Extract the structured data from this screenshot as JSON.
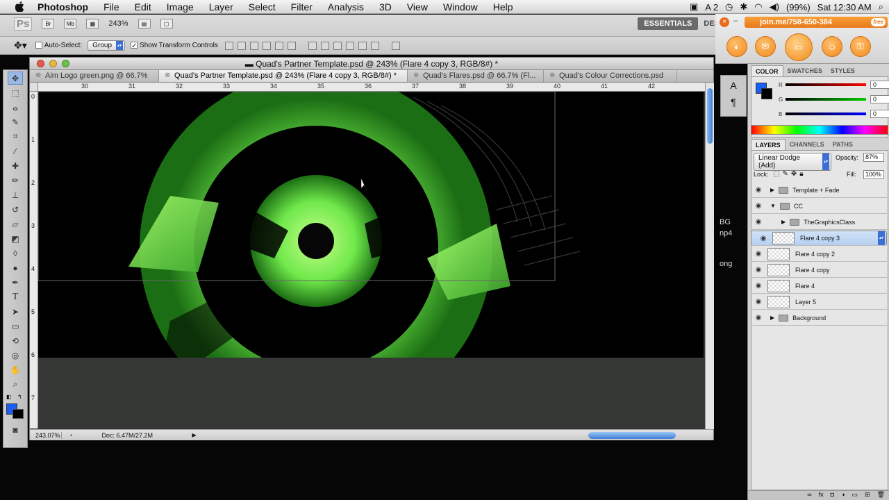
{
  "menubar": {
    "app": "Photoshop",
    "items": [
      "File",
      "Edit",
      "Image",
      "Layer",
      "Select",
      "Filter",
      "Analysis",
      "3D",
      "View",
      "Window",
      "Help"
    ],
    "status": {
      "adobe": "A 2",
      "battery": "(99%)",
      "clock": "Sat 12:30 AM"
    }
  },
  "options": {
    "ps_logo": "Ps",
    "br": "Br",
    "mb": "Mb",
    "zoom": "243%",
    "auto_select_label": "Auto-Select:",
    "auto_select_value": "Group",
    "show_transform": "Show Transform Controls",
    "essentials": "ESSENTIALS",
    "design": "DES"
  },
  "join": {
    "url": "join.me/758-650-384",
    "free": "free"
  },
  "document": {
    "title": "Quad's Partner Template.psd @ 243% (Flare 4 copy 3, RGB/8#) *",
    "tabs": [
      "Aim Logo green.png @ 66.7%",
      "Quad's Partner Template.psd @ 243% (Flare 4 copy 3, RGB/8#) *",
      "Quad's Flares.psd @ 66.7% (Fl...",
      "Quad's Colour Corrections.psd"
    ],
    "ruler_h": [
      "30",
      "31",
      "32",
      "33",
      "34",
      "35",
      "36",
      "37",
      "38",
      "39",
      "40",
      "41",
      "42"
    ],
    "ruler_v": [
      "0",
      "1",
      "2",
      "3",
      "4",
      "5",
      "6",
      "7"
    ],
    "status_zoom": "243.07%",
    "status_doc": "Doc: 6.47M/27.2M"
  },
  "color_panel": {
    "tabs": [
      "COLOR",
      "SWATCHES",
      "STYLES"
    ],
    "r_label": "R",
    "g_label": "G",
    "b_label": "B",
    "r": "0",
    "g": "0",
    "b": "0",
    "foreground": "#1a5ff5"
  },
  "layers_panel": {
    "tabs": [
      "LAYERS",
      "CHANNELS",
      "PATHS"
    ],
    "blend_mode": "Linear Dodge (Add)",
    "opacity_label": "Opacity:",
    "opacity": "87%",
    "lock_label": "Lock:",
    "fill_label": "Fill:",
    "fill": "100%",
    "layers": [
      {
        "name": "Template + Fade",
        "kind": "group",
        "indent": 0,
        "open": false,
        "selected": false
      },
      {
        "name": "CC",
        "kind": "group",
        "indent": 0,
        "open": true,
        "selected": false
      },
      {
        "name": "TheGraphicsClass",
        "kind": "group",
        "indent": 1,
        "open": false,
        "selected": false
      },
      {
        "name": "Flare 4 copy 3",
        "kind": "layer",
        "indent": 0,
        "open": false,
        "selected": true
      },
      {
        "name": "Flare 4 copy 2",
        "kind": "layer",
        "indent": 0,
        "open": false,
        "selected": false
      },
      {
        "name": "Flare 4 copy",
        "kind": "layer",
        "indent": 0,
        "open": false,
        "selected": false
      },
      {
        "name": "Flare 4",
        "kind": "layer",
        "indent": 0,
        "open": false,
        "selected": false
      },
      {
        "name": "Layer 5",
        "kind": "layer",
        "indent": 0,
        "open": false,
        "selected": false
      },
      {
        "name": "Background",
        "kind": "group",
        "indent": 0,
        "open": false,
        "selected": false
      }
    ]
  },
  "side_preview": [
    "BG",
    "np4",
    "ong"
  ],
  "colors": {
    "accent": "#3f7fd6",
    "flare": "#7cff5a",
    "join_orange": "#f08a1d"
  }
}
